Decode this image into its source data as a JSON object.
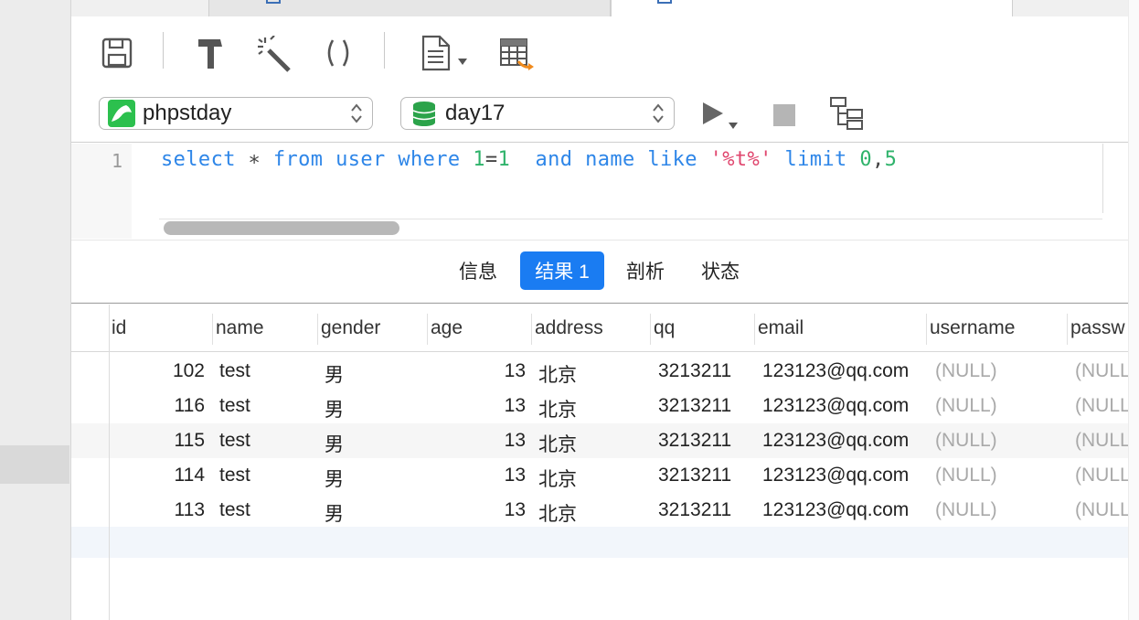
{
  "toolbar": {
    "icons": [
      "save-icon",
      "build-icon",
      "magic-wand-icon",
      "parentheses-icon",
      "document-icon",
      "table-export-icon"
    ]
  },
  "selectors": {
    "connection": "phpstday",
    "database": "day17"
  },
  "editor": {
    "line_number": "1",
    "tokens": [
      {
        "t": "select",
        "c": "#2e86e8"
      },
      {
        "t": " ∗ ",
        "c": "#444444"
      },
      {
        "t": "from",
        "c": "#2e86e8"
      },
      {
        "t": " ",
        "c": "#444444"
      },
      {
        "t": "user",
        "c": "#2e86e8"
      },
      {
        "t": " ",
        "c": "#444444"
      },
      {
        "t": "where",
        "c": "#2e86e8"
      },
      {
        "t": " ",
        "c": "#444444"
      },
      {
        "t": "1",
        "c": "#2fb36b"
      },
      {
        "t": "=",
        "c": "#444444"
      },
      {
        "t": "1",
        "c": "#2fb36b"
      },
      {
        "t": "  ",
        "c": "#444444"
      },
      {
        "t": "and",
        "c": "#2e86e8"
      },
      {
        "t": " ",
        "c": "#444444"
      },
      {
        "t": "name",
        "c": "#2e86e8"
      },
      {
        "t": " ",
        "c": "#444444"
      },
      {
        "t": "like",
        "c": "#2e86e8"
      },
      {
        "t": " ",
        "c": "#444444"
      },
      {
        "t": "'%t%'",
        "c": "#e0466e"
      },
      {
        "t": " ",
        "c": "#444444"
      },
      {
        "t": "limit",
        "c": "#2e86e8"
      },
      {
        "t": " ",
        "c": "#444444"
      },
      {
        "t": "0",
        "c": "#2fb36b"
      },
      {
        "t": ",",
        "c": "#444444"
      },
      {
        "t": "5",
        "c": "#2fb36b"
      }
    ]
  },
  "result_tabs": [
    "信息",
    "结果 1",
    "剖析",
    "状态"
  ],
  "active_result_tab": 1,
  "table": {
    "columns": [
      "id",
      "name",
      "gender",
      "age",
      "address",
      "qq",
      "email",
      "username",
      "passw"
    ],
    "rows": [
      [
        "102",
        "test",
        "男",
        "13",
        "北京",
        "3213211",
        "123123@qq.com",
        "(NULL)",
        "(NULL"
      ],
      [
        "116",
        "test",
        "男",
        "13",
        "北京",
        "3213211",
        "123123@qq.com",
        "(NULL)",
        "(NULL"
      ],
      [
        "115",
        "test",
        "男",
        "13",
        "北京",
        "3213211",
        "123123@qq.com",
        "(NULL)",
        "(NULL"
      ],
      [
        "114",
        "test",
        "男",
        "13",
        "北京",
        "3213211",
        "123123@qq.com",
        "(NULL)",
        "(NULL"
      ],
      [
        "113",
        "test",
        "男",
        "13",
        "北京",
        "3213211",
        "123123@qq.com",
        "(NULL)",
        "(NULL"
      ]
    ]
  },
  "colors": {
    "accent": "#1a7cf2",
    "keyword": "#2e86e8",
    "number": "#2fb36b",
    "string": "#e0466e",
    "null": "#a9a9a9"
  }
}
